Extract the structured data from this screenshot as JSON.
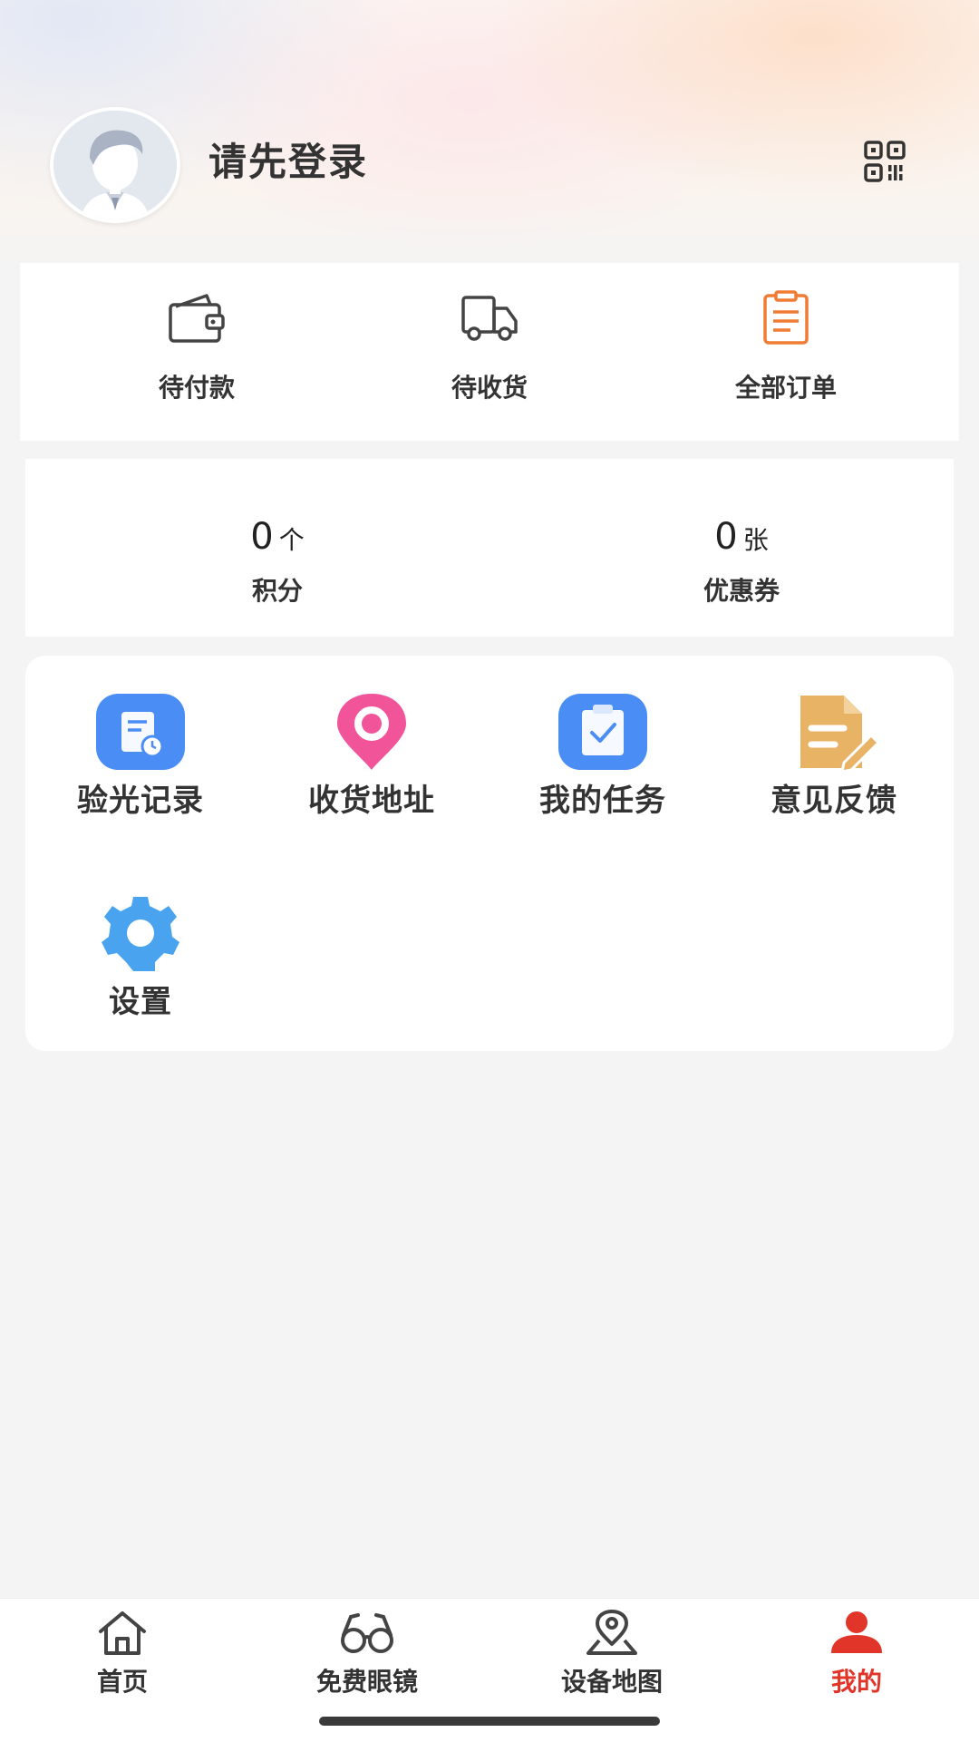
{
  "header": {
    "login_prompt": "请先登录",
    "avatar_icon": "default-user-avatar",
    "qr_icon": "qr-code-icon"
  },
  "orders": [
    {
      "label": "待付款",
      "icon": "wallet-icon"
    },
    {
      "label": "待收货",
      "icon": "truck-icon"
    },
    {
      "label": "全部订单",
      "icon": "clipboard-icon"
    }
  ],
  "stats": [
    {
      "value": "0",
      "unit": "个",
      "label": "积分"
    },
    {
      "value": "0",
      "unit": "张",
      "label": "优惠券"
    }
  ],
  "tools": [
    {
      "label": "验光记录",
      "icon": "eye-record-icon"
    },
    {
      "label": "收货地址",
      "icon": "location-pin-icon"
    },
    {
      "label": "我的任务",
      "icon": "task-clipboard-icon"
    },
    {
      "label": "意见反馈",
      "icon": "feedback-icon"
    },
    {
      "label": "设置",
      "icon": "gear-icon"
    }
  ],
  "tabbar": {
    "items": [
      {
        "label": "首页",
        "icon": "home-icon"
      },
      {
        "label": "免费眼镜",
        "icon": "glasses-icon"
      },
      {
        "label": "设备地图",
        "icon": "map-pin-icon"
      },
      {
        "label": "我的",
        "icon": "user-icon"
      }
    ],
    "active_index": 3
  },
  "colors": {
    "accent": "#e2352a",
    "orange_icon": "#f07b32",
    "blue_icon": "#4a8ef5",
    "pink_icon": "#f2549a",
    "gold_icon": "#e8b365"
  }
}
